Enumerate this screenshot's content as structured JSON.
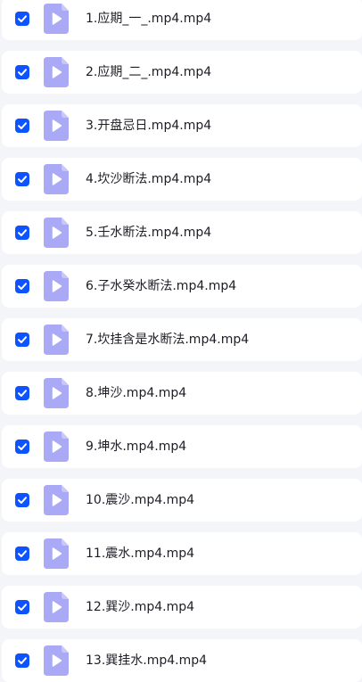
{
  "files": [
    {
      "name": "1.应期_一_.mp4.mp4",
      "checked": true,
      "icon": "video-file-icon"
    },
    {
      "name": "2.应期_二_.mp4.mp4",
      "checked": true,
      "icon": "video-file-icon"
    },
    {
      "name": "3.开盘忌日.mp4.mp4",
      "checked": true,
      "icon": "video-file-icon"
    },
    {
      "name": "4.坎沙断法.mp4.mp4",
      "checked": true,
      "icon": "video-file-icon"
    },
    {
      "name": "5.壬水断法.mp4.mp4",
      "checked": true,
      "icon": "video-file-icon"
    },
    {
      "name": "6.子水癸水断法.mp4.mp4",
      "checked": true,
      "icon": "video-file-icon"
    },
    {
      "name": "7.坎挂含是水断法.mp4.mp4",
      "checked": true,
      "icon": "video-file-icon"
    },
    {
      "name": "8.坤沙.mp4.mp4",
      "checked": true,
      "icon": "video-file-icon"
    },
    {
      "name": "9.坤水.mp4.mp4",
      "checked": true,
      "icon": "video-file-icon"
    },
    {
      "name": "10.震沙.mp4.mp4",
      "checked": true,
      "icon": "video-file-icon"
    },
    {
      "name": "11.震水.mp4.mp4",
      "checked": true,
      "icon": "video-file-icon"
    },
    {
      "name": "12.巽沙.mp4.mp4",
      "checked": true,
      "icon": "video-file-icon"
    },
    {
      "name": "13.巽挂水.mp4.mp4",
      "checked": true,
      "icon": "video-file-icon"
    }
  ],
  "colors": {
    "checkbox": "#0d53ff",
    "file_icon": "#a9a9f6",
    "row_background": "#ffffff",
    "page_background": "#f4f5f9"
  }
}
